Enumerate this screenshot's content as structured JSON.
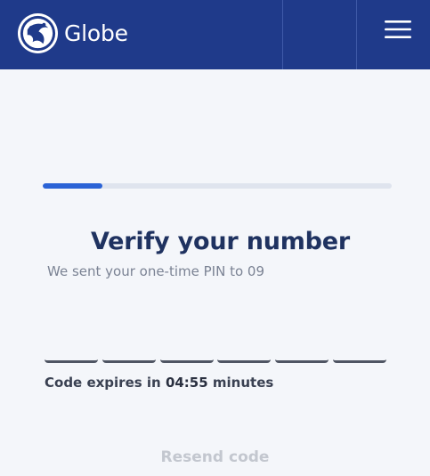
{
  "header": {
    "brand": "Globe",
    "logo_icon": "globe-logo-icon",
    "menu_icon": "hamburger-menu-icon",
    "background": "#1f3a8a"
  },
  "progress": {
    "fraction": 0.17,
    "fill_color": "#2b63d6",
    "track_color": "#dfe4ee"
  },
  "verify": {
    "title": "Verify your number",
    "subtitle": "We sent your one-time PIN to 09",
    "pin_digits": [
      "",
      "",
      "",
      "",
      "",
      ""
    ],
    "expiry_prefix": "Code expires in ",
    "expiry_time": "04:55",
    "expiry_suffix": " minutes",
    "resend_label": "Resend code"
  }
}
